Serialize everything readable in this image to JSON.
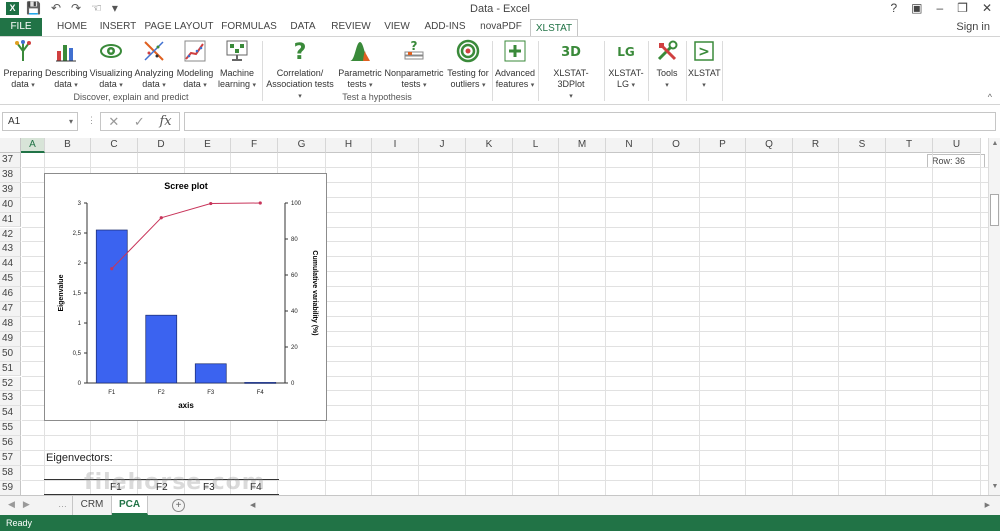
{
  "window": {
    "title": "Data - Excel",
    "app_icon": "X",
    "controls": [
      "?",
      "▣",
      "–",
      "❐",
      "✕"
    ]
  },
  "quick_access": [
    "save-icon",
    "undo-icon",
    "redo-icon",
    "touch-mode-icon",
    "customize-icon"
  ],
  "tabs": [
    {
      "label": "FILE"
    },
    {
      "label": "HOME"
    },
    {
      "label": "INSERT"
    },
    {
      "label": "PAGE LAYOUT"
    },
    {
      "label": "FORMULAS"
    },
    {
      "label": "DATA"
    },
    {
      "label": "REVIEW"
    },
    {
      "label": "VIEW"
    },
    {
      "label": "ADD-INS"
    },
    {
      "label": "novaPDF"
    },
    {
      "label": "XLSTAT"
    }
  ],
  "signin": "Sign in",
  "ribbon": {
    "buttons": [
      {
        "l1": "Preparing",
        "l2": "data"
      },
      {
        "l1": "Describing",
        "l2": "data"
      },
      {
        "l1": "Visualizing",
        "l2": "data"
      },
      {
        "l1": "Analyzing",
        "l2": "data"
      },
      {
        "l1": "Modeling",
        "l2": "data"
      },
      {
        "l1": "Machine",
        "l2": "learning"
      },
      {
        "l1": "Correlation/",
        "l2": "Association tests"
      },
      {
        "l1": "Parametric",
        "l2": "tests"
      },
      {
        "l1": "Nonparametric",
        "l2": "tests"
      },
      {
        "l1": "Testing for",
        "l2": "outliers"
      },
      {
        "l1": "Advanced",
        "l2": "features"
      },
      {
        "l1": "XLSTAT-3DPlot",
        "l2": ""
      },
      {
        "l1": "XLSTAT-",
        "l2": "LG"
      },
      {
        "l1": "Tools",
        "l2": ""
      },
      {
        "l1": "XLSTAT",
        "l2": ""
      }
    ],
    "groups": [
      "Discover, explain and predict",
      "Test a hypothesis"
    ],
    "icon_texts": {
      "plot3d": "3D",
      "lg": "LG",
      "xlstat": ">"
    }
  },
  "formula_bar": {
    "cell_ref": "A1",
    "fx_label": "fx",
    "value": ""
  },
  "columns": [
    "A",
    "B",
    "C",
    "D",
    "E",
    "F",
    "G",
    "H",
    "I",
    "J",
    "K",
    "L",
    "M",
    "N",
    "O",
    "P",
    "Q",
    "R",
    "S",
    "T",
    "U"
  ],
  "rows": [
    "37",
    "38",
    "39",
    "40",
    "41",
    "42",
    "43",
    "44",
    "45",
    "46",
    "47",
    "48",
    "49",
    "50",
    "51",
    "52",
    "53",
    "54",
    "55",
    "56",
    "57",
    "58",
    "59"
  ],
  "row_tooltip": "Row: 36",
  "chart_data": {
    "type": "bar",
    "title": "Scree plot",
    "xlabel": "axis",
    "ylabel": "Eigenvalue",
    "y2label": "Cumulative variability (%)",
    "categories": [
      "F1",
      "F2",
      "F3",
      "F4"
    ],
    "series": [
      {
        "values": [
          2.55,
          1.13,
          0.32,
          0.01
        ],
        "axis": "left",
        "kind": "bar",
        "color": "#3b63f0"
      },
      {
        "values": [
          63.5,
          91.8,
          99.7,
          100
        ],
        "axis": "right",
        "kind": "line",
        "color": "#c8345a"
      }
    ],
    "ylim": [
      0,
      3
    ],
    "yticks": [
      "0",
      "0,5",
      "1",
      "1,5",
      "2",
      "2,5",
      "3"
    ],
    "y2lim": [
      0,
      100
    ],
    "y2ticks": [
      "0",
      "20",
      "40",
      "60",
      "80",
      "100"
    ],
    "grid": false
  },
  "eigen": {
    "label": "Eigenvectors:",
    "headers": [
      "F1",
      "F2",
      "F3",
      "F4"
    ]
  },
  "sheets": [
    {
      "label": "CRM"
    },
    {
      "label": "PCA"
    }
  ],
  "status": {
    "text": "Ready"
  },
  "watermark": "filehorse.com"
}
